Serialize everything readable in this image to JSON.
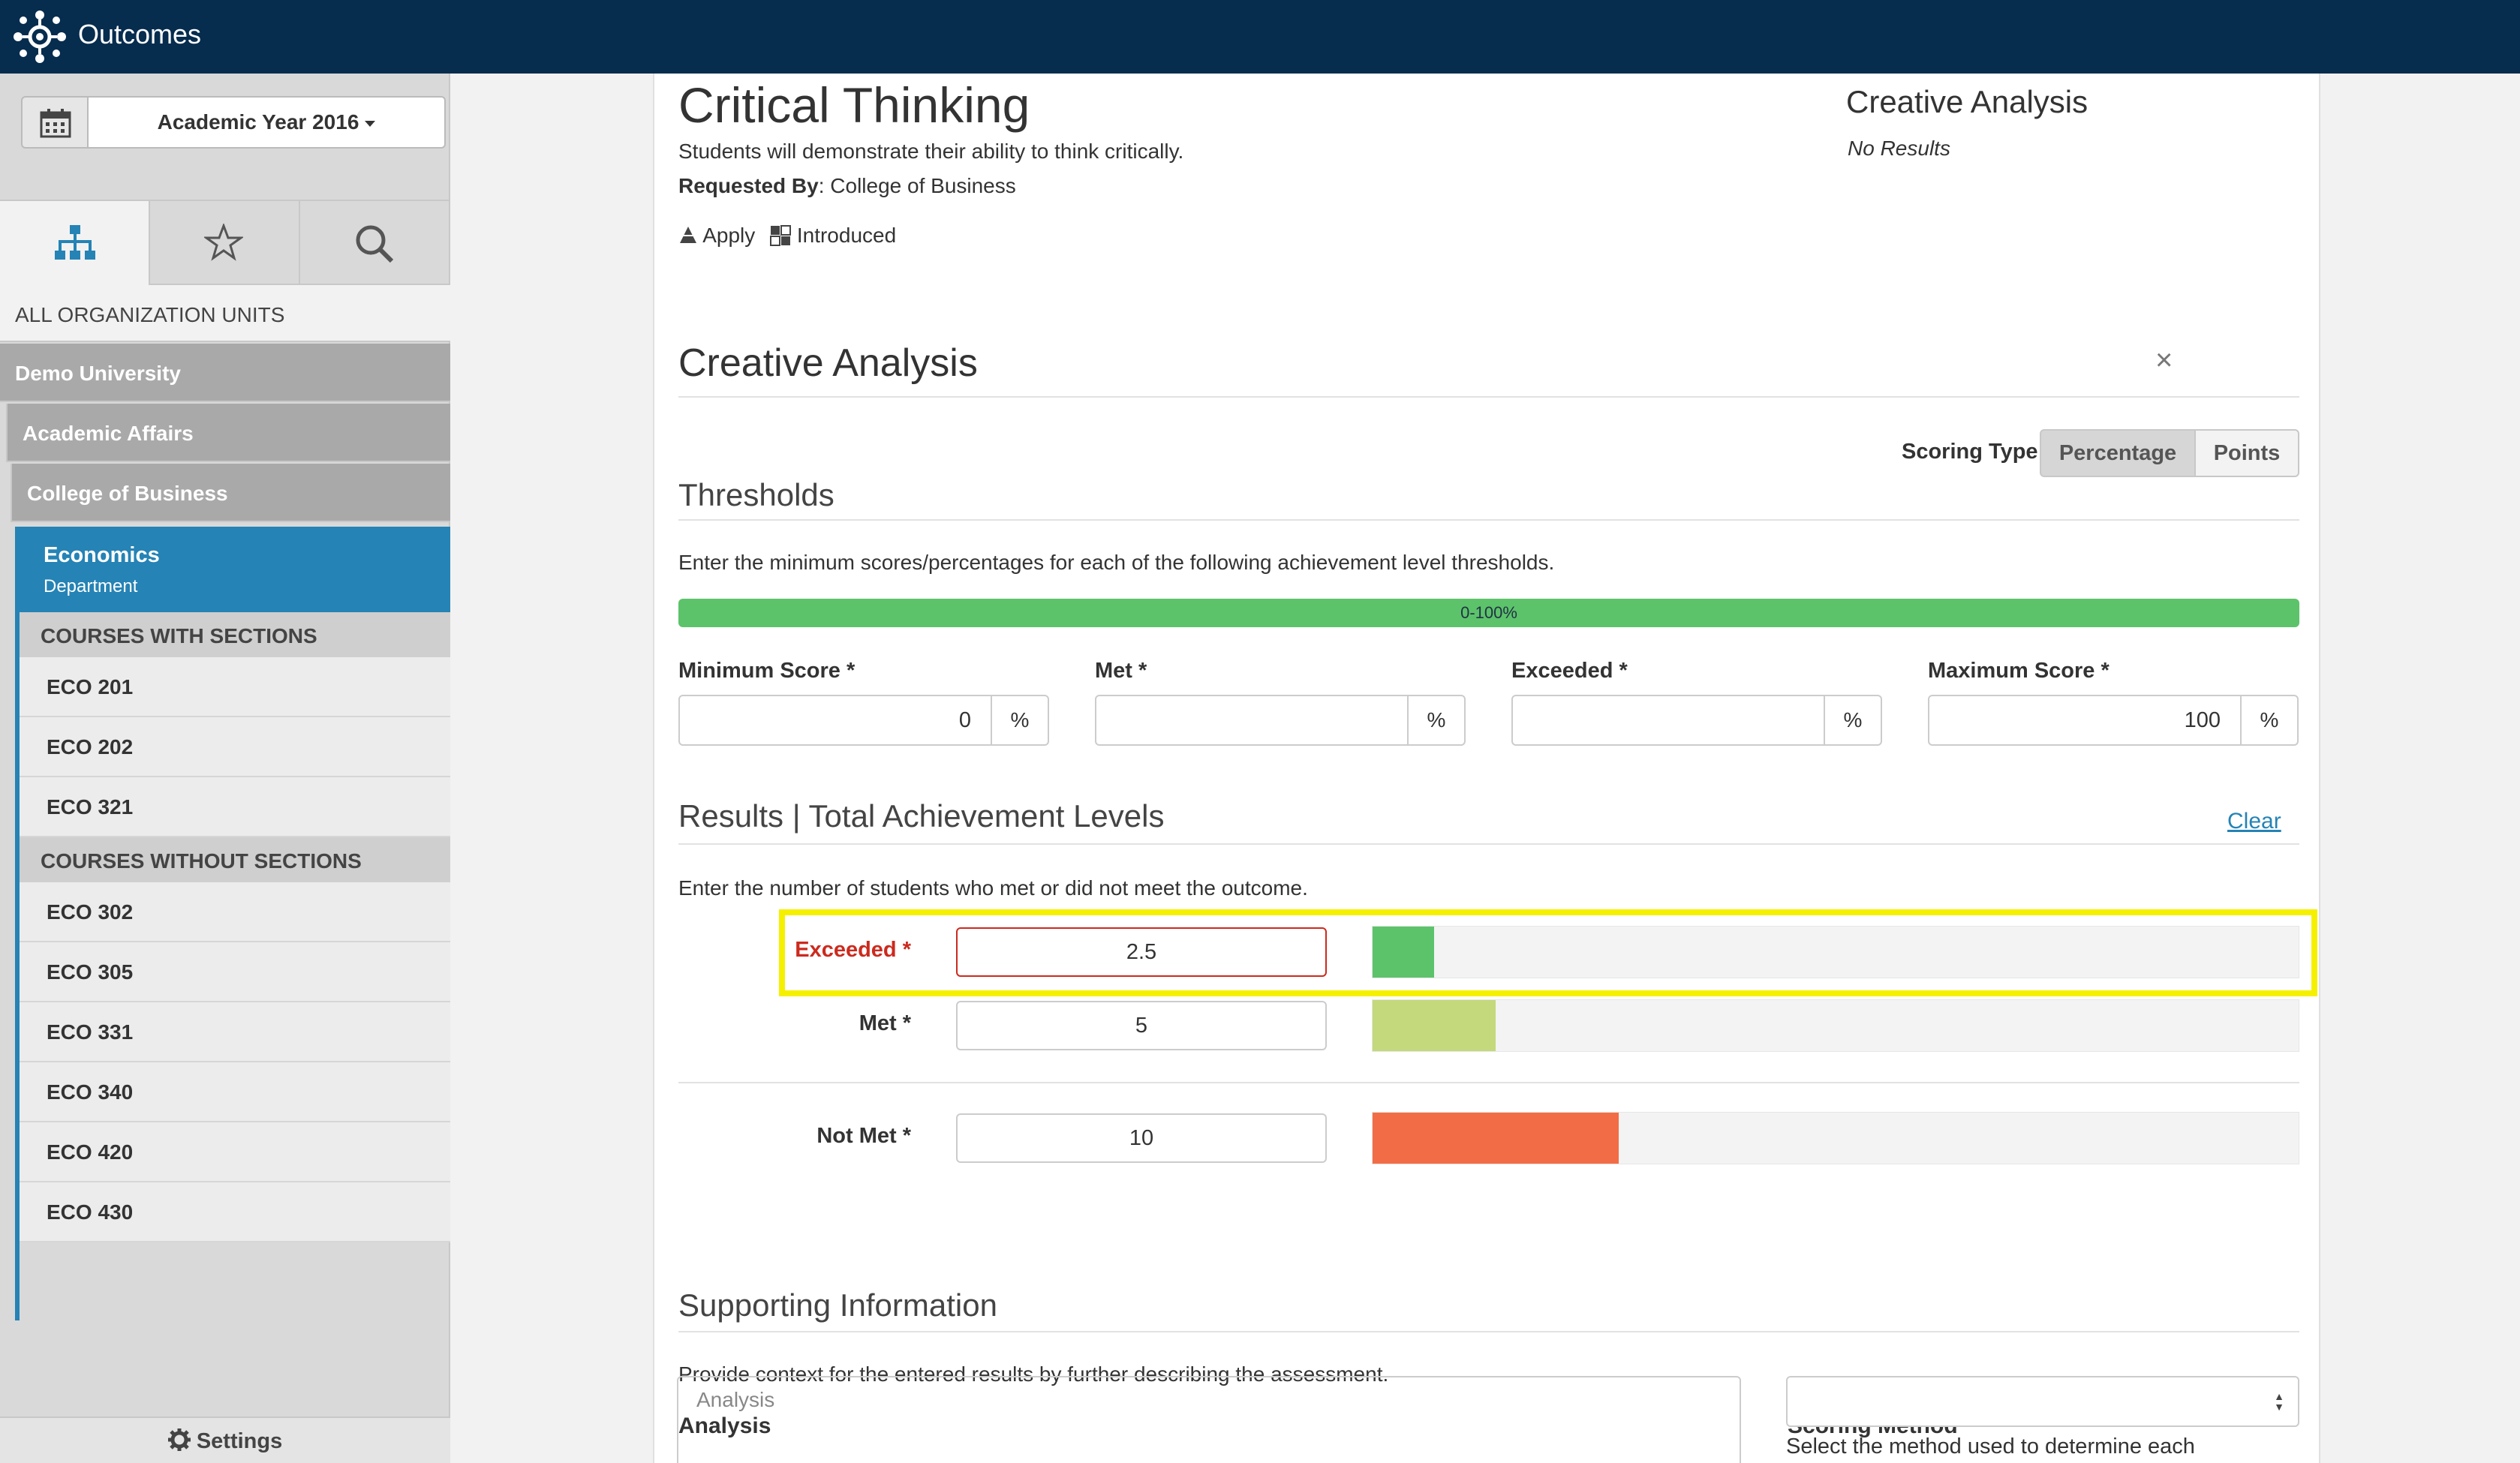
{
  "app": {
    "title": "Outcomes",
    "logo_icon": "network-logo-icon"
  },
  "sidebar": {
    "year_label": "Academic Year 2016",
    "all_units_label": "ALL ORGANIZATION UNITS",
    "tree": [
      "Demo University",
      "Academic Affairs",
      "College of Business"
    ],
    "selected": {
      "name": "Economics",
      "type": "Department"
    },
    "courses_with_sections_header": "COURSES WITH SECTIONS",
    "courses_with_sections": [
      "ECO 201",
      "ECO 202",
      "ECO 321"
    ],
    "courses_without_sections_header": "COURSES WITHOUT SECTIONS",
    "courses_without_sections": [
      "ECO 302",
      "ECO 305",
      "ECO 331",
      "ECO 340",
      "ECO 420",
      "ECO 430"
    ],
    "settings_label": "Settings"
  },
  "outcome": {
    "title": "Critical Thinking",
    "description": "Students will demonstrate their ability to think critically.",
    "requested_by_label": "Requested By",
    "requested_by_value": ": College of Business",
    "tag1": "Apply",
    "tag2": "Introduced"
  },
  "summary": {
    "title": "Creative Analysis",
    "status": "No Results"
  },
  "assessment": {
    "title": "Creative Analysis",
    "close": "×",
    "scoring_type_label": "Scoring Type",
    "scoring_options": [
      "Percentage",
      "Points"
    ],
    "scoring_selected": "Percentage"
  },
  "thresholds": {
    "heading": "Thresholds",
    "help": "Enter the minimum scores/percentages for each of the following achievement level thresholds.",
    "range_label": "0-100%",
    "fields": [
      {
        "label": "Minimum Score *",
        "value": "0",
        "unit": "%"
      },
      {
        "label": "Met *",
        "value": "",
        "unit": "%"
      },
      {
        "label": "Exceeded *",
        "value": "",
        "unit": "%"
      },
      {
        "label": "Maximum Score *",
        "value": "100",
        "unit": "%"
      }
    ]
  },
  "results": {
    "heading": "Results | Total Achievement Levels",
    "clear_label": "Clear",
    "help": "Enter the number of students who met or did not meet the outcome.",
    "rows": [
      {
        "label": "Exceeded *",
        "value": "2.5",
        "bar_fraction": 0.0664,
        "color": "#5cc36b",
        "error": true
      },
      {
        "label": "Met *",
        "value": "5",
        "bar_fraction": 0.1328,
        "color": "#c3d97c",
        "error": false
      },
      {
        "label": "Not Met *",
        "value": "10",
        "bar_fraction": 0.2656,
        "color": "#f26d45",
        "error": false
      }
    ]
  },
  "supporting": {
    "heading": "Supporting Information",
    "help": "Provide context for the entered results by further describing the assessment.",
    "analysis_label": "Analysis",
    "analysis_placeholder": "Analysis",
    "scoring_method_label": "Scoring Method",
    "scoring_method_help": "Select the method used to determine each"
  },
  "colors": {
    "topbar": "#062c4e",
    "accent": "#2583b5",
    "error": "#cc2a1e",
    "highlight": "#f5f000"
  }
}
